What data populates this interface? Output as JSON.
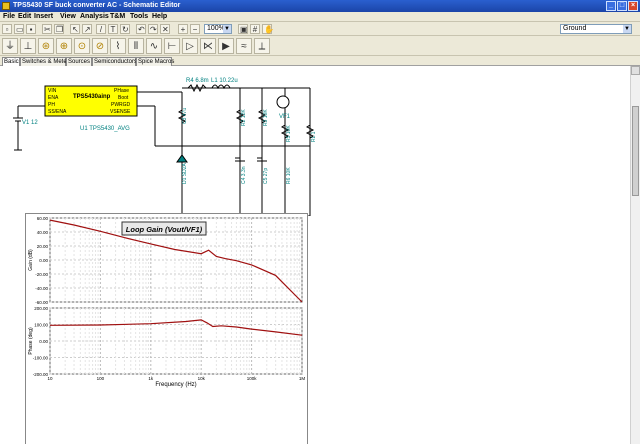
{
  "window": {
    "title": "TPS5430 SF buck converter AC - Schematic Editor",
    "minimize": "_",
    "maximize": "□",
    "close": "×"
  },
  "menu": [
    "File",
    "Edit",
    "Insert",
    "View",
    "Analysis",
    "T&M",
    "Tools",
    "Help"
  ],
  "toolbar": {
    "zoom_value": "100%",
    "layer_value": "Ground"
  },
  "tabs": [
    "Basic",
    "Switches & Meters",
    "Sources",
    "Semiconductors",
    "Spice Macros"
  ],
  "schematic": {
    "ic_name": "TPS5430ainp",
    "ic_pins_left": [
      "VIN",
      "ENA",
      "PH",
      "SS/ENA"
    ],
    "ic_pins_right": [
      "PHase",
      "Boot",
      "PWRGD",
      "VSENSE"
    ],
    "ic_label": "U1 TPS5430_AVG",
    "source_label": "V1 12",
    "labels": {
      "r1": "R4 6.8m",
      "l1": "L1 10.22u",
      "c_out": "C3 47u",
      "r2": "R2 12K",
      "r3": "R3 10K",
      "c4": "C4 3.3n",
      "c5": "C5 27p",
      "r5": "R5 10K",
      "r6": "R6 10K",
      "d1": "D1 SD2A",
      "vf": "VF1",
      "rl": "RL 1"
    }
  },
  "chart_data": [
    {
      "type": "line",
      "title": "Loop Gain (Vout/VF1)",
      "xlabel": "Frequency (Hz)",
      "ylabel": "Gain (dB)",
      "xscale": "log",
      "xlim": [
        10,
        1000000
      ],
      "ylim": [
        -60,
        60
      ],
      "yticks": [
        "60.00",
        "40.00",
        "20.00",
        "0.00",
        "-20.00",
        "-40.00",
        "-60.00"
      ],
      "series": [
        {
          "x": [
            10,
            30,
            100,
            300,
            1000,
            3000,
            10000,
            14000,
            20000,
            30000,
            50000,
            100000,
            300000,
            1000000
          ],
          "y": [
            57,
            50,
            41,
            32,
            23,
            15,
            9,
            14,
            5,
            2,
            -1,
            -7,
            -22,
            -60
          ]
        }
      ]
    },
    {
      "type": "line",
      "xlabel": "Frequency (Hz)",
      "ylabel": "Phase (deg)",
      "xscale": "log",
      "xlim": [
        10,
        1000000
      ],
      "ylim": [
        -200,
        200
      ],
      "yticks": [
        "200.00",
        "100.00",
        "0.00",
        "-100.00",
        "-200.00"
      ],
      "xticks": [
        "10",
        "100",
        "1k",
        "10k",
        "100k",
        "1M"
      ],
      "series": [
        {
          "x": [
            10,
            100,
            1000,
            5000,
            10000,
            13000,
            17000,
            25000,
            50000,
            100000,
            300000,
            1000000
          ],
          "y": [
            95,
            97,
            105,
            118,
            128,
            110,
            88,
            92,
            85,
            72,
            55,
            35
          ]
        }
      ]
    }
  ]
}
